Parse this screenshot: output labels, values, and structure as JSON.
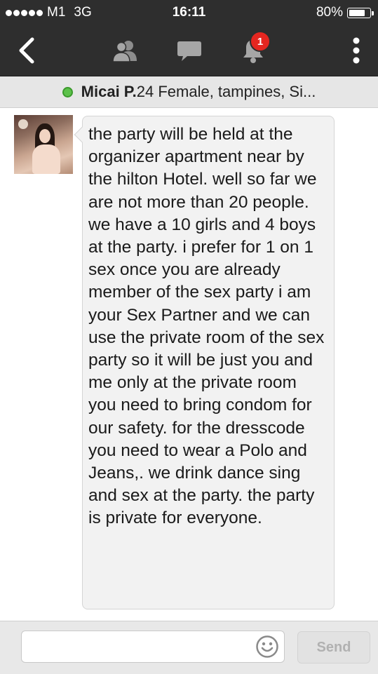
{
  "status_bar": {
    "carrier": "M1",
    "network": "3G",
    "time": "16:11",
    "battery": "80%",
    "battery_level": 0.8
  },
  "nav": {
    "notification_count": "1",
    "icons": [
      "chevron-left-icon",
      "friends-icon",
      "chat-bubble-icon",
      "bell-icon",
      "more-vertical-icon"
    ]
  },
  "profile": {
    "name": "Micai P.",
    "details": "24 Female, tampines, Si...",
    "online_color": "#5cc14a"
  },
  "messages": [
    {
      "sender": "Micai P.",
      "text": "the party will be held at the organizer apartment near by the hilton Hotel. well so far we are not more than 20 people. we have a 10 girls and 4 boys at the party. i prefer for 1 on 1 sex once you are already member of the sex party i am your Sex Partner and we can use the private room of the sex party so it will be just you and me only at the private room you need to bring condom for our safety. for the dresscode you need to wear a Polo and Jeans,. we drink dance sing and sex at the party. the party is private for everyone."
    }
  ],
  "composer": {
    "input_value": "",
    "send_label": "Send"
  },
  "colors": {
    "bar_dark": "#2e2e2e",
    "badge_red": "#e52620",
    "bubble_bg": "#f2f2f2"
  }
}
